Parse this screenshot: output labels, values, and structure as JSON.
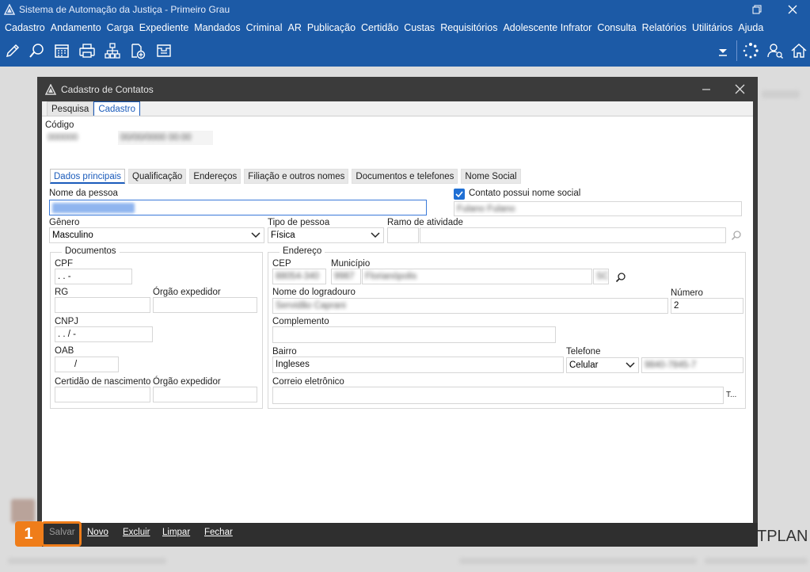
{
  "window": {
    "title": "Sistema de Automação da Justiça - Primeiro Grau",
    "restore_icon": "restore-icon",
    "close_icon": "close-icon"
  },
  "menu": [
    "Cadastro",
    "Andamento",
    "Carga",
    "Expediente",
    "Mandados",
    "Criminal",
    "AR",
    "Publicação",
    "Certidão",
    "Custas",
    "Requisitórios",
    "Adolescente Infrator",
    "Consulta",
    "Relatórios",
    "Utilitários",
    "Ajuda"
  ],
  "toolbar": {
    "left_icons": [
      "edit-icon",
      "search-process-icon",
      "calendar-icon",
      "printer-icon",
      "org-chart-icon",
      "add-document-icon",
      "tray-icon"
    ],
    "right_icons": [
      "dropdown-arrow-icon",
      "loading-icon",
      "user-search-icon",
      "home-icon"
    ]
  },
  "dialog": {
    "title": "Cadastro de Contatos",
    "tabs": [
      "Pesquisa",
      "Cadastro"
    ],
    "active_tab": "Cadastro",
    "codigo_label": "Código",
    "subtabs": [
      "Dados principais",
      "Qualificação",
      "Endereços",
      "Filiação e outros nomes",
      "Documentos e telefones",
      "Nome Social"
    ],
    "active_subtab": "Dados principais",
    "nome_label": "Nome da pessoa",
    "nome_social_checkbox": "Contato possui nome social",
    "genero_label": "Gênero",
    "genero_value": "Masculino",
    "tipo_label": "Tipo de pessoa",
    "tipo_value": "Física",
    "ramo_label": "Ramo de atividade",
    "documentos": {
      "title": "Documentos",
      "cpf_label": "CPF",
      "cpf_mask": " .  .  -",
      "rg_label": "RG",
      "orgao_label": "Órgão expedidor",
      "cnpj_label": "CNPJ",
      "cnpj_mask": " .  .  /  -",
      "oab_label": "OAB",
      "oab_mask": "/",
      "certidao_label": "Certidão de nascimento",
      "orgao2_label": "Órgão expedidor"
    },
    "endereco": {
      "title": "Endereço",
      "cep_label": "CEP",
      "municipio_label": "Município",
      "logradouro_label": "Nome do logradouro",
      "numero_label": "Número",
      "numero_value": "2",
      "complemento_label": "Complemento",
      "bairro_label": "Bairro",
      "bairro_value": "Ingleses",
      "telefone_label": "Telefone",
      "telefone_tipo": "Celular",
      "email_label": "Correio eletrônico",
      "email_btn": "T..."
    },
    "footer": {
      "salvar": "Salvar",
      "novo": "Novo",
      "excluir": "Excluir",
      "limpar": "Limpar",
      "fechar": "Fechar"
    }
  },
  "callout": "1",
  "watermark": "TPLAN",
  "colors": {
    "titlebar": "#1c5aa6",
    "dialog_dark": "#3b3b3b",
    "accent": "#1a5bbb",
    "callout": "#ef7d1a"
  }
}
